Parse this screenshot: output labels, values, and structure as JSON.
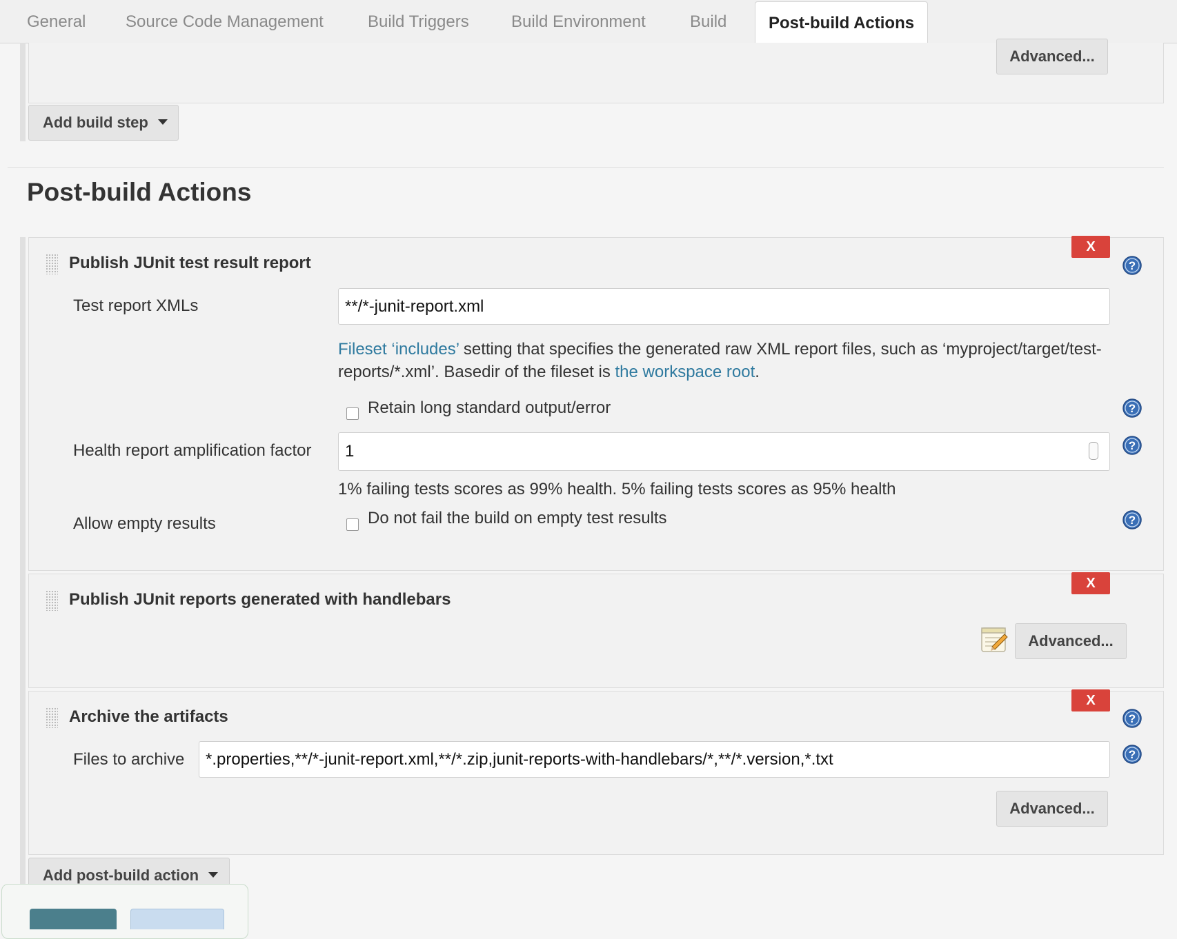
{
  "tabs": [
    {
      "label": "General"
    },
    {
      "label": "Source Code Management"
    },
    {
      "label": "Build Triggers"
    },
    {
      "label": "Build Environment"
    },
    {
      "label": "Build"
    },
    {
      "label": "Post-build Actions",
      "active": true
    }
  ],
  "build_section": {
    "advanced_label": "Advanced...",
    "add_build_step_label": "Add build step"
  },
  "post_build": {
    "heading": "Post-build Actions",
    "junit": {
      "title": "Publish JUnit test result report",
      "remove_label": "X",
      "test_report_label": "Test report XMLs",
      "test_report_value": "**/*-junit-report.xml",
      "desc_link1": "Fileset ‘includes’",
      "desc_text1": " setting that specifies the generated raw XML report files, such as ‘myproject/target/test-reports/*.xml’. Basedir of the fileset is ",
      "desc_link2": "the workspace root",
      "desc_text2": ".",
      "retain_label": "Retain long standard output/error",
      "retain_checked": false,
      "health_label": "Health report amplification factor",
      "health_value": "1",
      "health_desc": "1% failing tests scores as 99% health. 5% failing tests scores as 95% health",
      "allow_empty_label": "Allow empty results",
      "allow_empty_checkbox_label": "Do not fail the build on empty test results",
      "allow_empty_checked": false
    },
    "handlebars": {
      "title": "Publish JUnit reports generated with handlebars",
      "remove_label": "X",
      "advanced_label": "Advanced..."
    },
    "archive": {
      "title": "Archive the artifacts",
      "remove_label": "X",
      "files_label": "Files to archive",
      "files_value": "*.properties,**/*-junit-report.xml,**/*.zip,junit-reports-with-handlebars/*,**/*.version,*.txt",
      "advanced_label": "Advanced..."
    },
    "add_action_label": "Add post-build action"
  },
  "colors": {
    "remove_button": "#d9433b",
    "link": "#2f7a9f",
    "save_button": "#4b7f8c",
    "apply_button": "#c9dcef"
  }
}
